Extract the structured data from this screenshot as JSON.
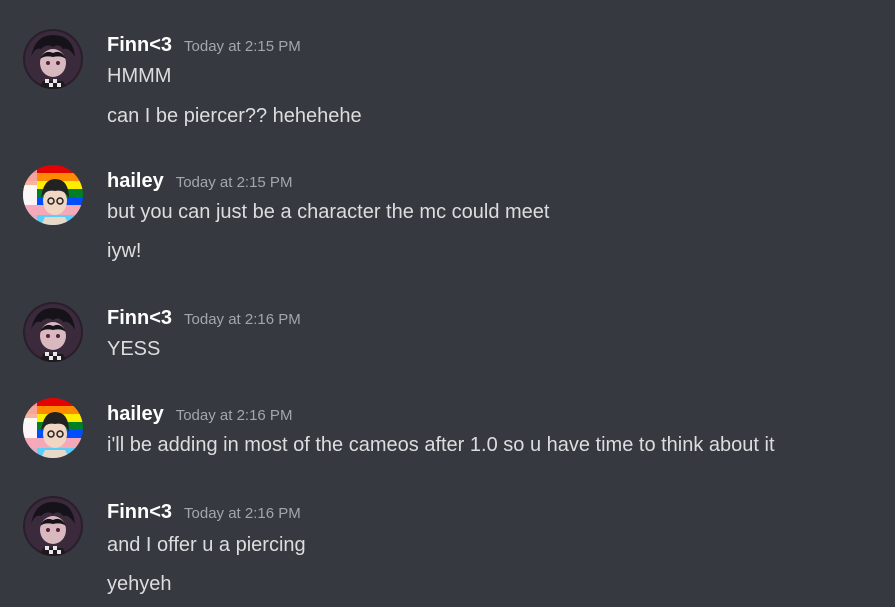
{
  "messages": [
    {
      "author": "Finn<3",
      "timestamp": "Today at 2:15 PM",
      "avatar": "finn-avatar",
      "lines": [
        "HMMM",
        "can I be piercer?? hehehehe"
      ]
    },
    {
      "author": "hailey",
      "timestamp": "Today at 2:15 PM",
      "avatar": "hailey-avatar",
      "lines": [
        "but you can just be a character the mc could meet",
        "iyw!"
      ]
    },
    {
      "author": "Finn<3",
      "timestamp": "Today at 2:16 PM",
      "avatar": "finn-avatar",
      "lines": [
        "YESS"
      ]
    },
    {
      "author": "hailey",
      "timestamp": "Today at 2:16 PM",
      "avatar": "hailey-avatar",
      "lines": [
        "i'll be adding in most of the cameos after 1.0 so u have time to think about it"
      ]
    },
    {
      "author": "Finn<3",
      "timestamp": "Today at 2:16 PM",
      "avatar": "finn-avatar",
      "lines": [
        "and I offer u a piercing",
        "yehyeh"
      ]
    }
  ],
  "colors": {
    "background": "#36393f",
    "username": "#ffffff",
    "timestamp": "#a3a6aa",
    "message_text": "#dcddde"
  }
}
